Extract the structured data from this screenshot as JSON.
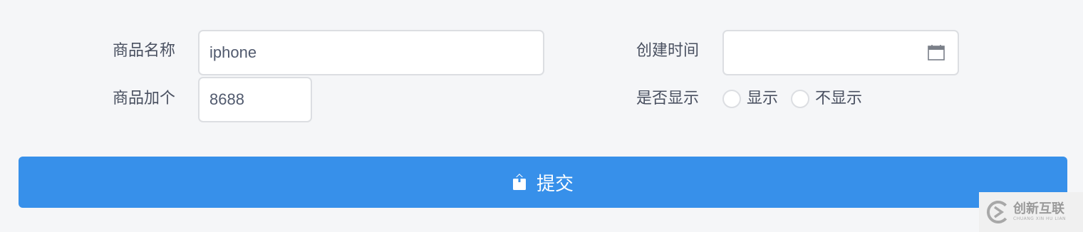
{
  "form": {
    "name": {
      "label": "商品名称",
      "value": "iphone"
    },
    "price": {
      "label": "商品加个",
      "value": "8688"
    },
    "created": {
      "label": "创建时间",
      "value": "",
      "icon": "calendar-icon"
    },
    "visible": {
      "label": "是否显示",
      "options": [
        "显示",
        "不显示"
      ]
    }
  },
  "submit": {
    "label": "提交",
    "icon": "upload-icon",
    "color": "#3790ea"
  },
  "watermark": {
    "main": "创新互联",
    "sub": "CHUANG XIN HU LIAN"
  }
}
